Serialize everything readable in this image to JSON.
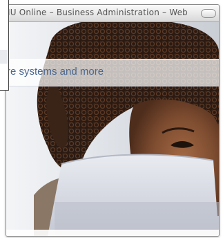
{
  "window": {
    "title": "IU Online – Business Administration – Web"
  },
  "page": {
    "banner_text": "re systems and more"
  },
  "colors": {
    "banner_text": "#4a6790",
    "title_text": "#555555"
  }
}
